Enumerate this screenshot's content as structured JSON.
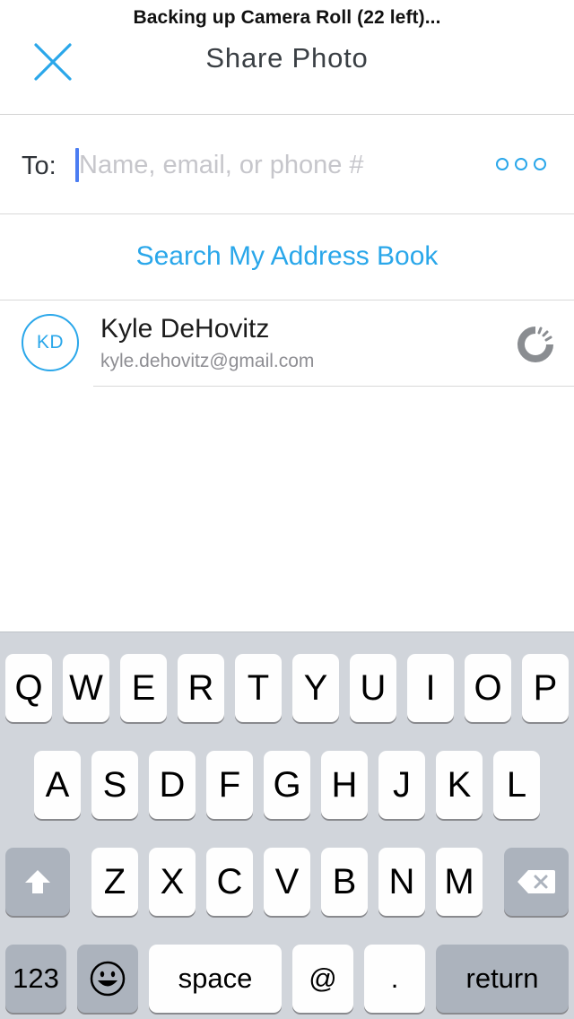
{
  "status": {
    "text": "Backing up Camera Roll (22 left)..."
  },
  "nav": {
    "title": "Share Photo",
    "close_icon": "close-icon"
  },
  "recipient": {
    "label": "To:",
    "value": "",
    "placeholder": "Name, email, or phone #",
    "more_icon": "more-icon"
  },
  "address_book": {
    "label": "Search My Address Book"
  },
  "contacts": [
    {
      "initials": "KD",
      "name": "Kyle DeHovitz",
      "email": "kyle.dehovitz@gmail.com",
      "status_icon": "loading-spinner-icon"
    }
  ],
  "keyboard": {
    "row1": [
      "Q",
      "W",
      "E",
      "R",
      "T",
      "Y",
      "U",
      "I",
      "O",
      "P"
    ],
    "row2": [
      "A",
      "S",
      "D",
      "F",
      "G",
      "H",
      "J",
      "K",
      "L"
    ],
    "row3": [
      "Z",
      "X",
      "C",
      "V",
      "B",
      "N",
      "M"
    ],
    "numbers_label": "123",
    "emoji_icon": "emoji-icon",
    "space_label": "space",
    "at_label": "@",
    "period_label": ".",
    "return_label": "return",
    "shift_icon": "shift-icon",
    "backspace_icon": "backspace-icon"
  },
  "colors": {
    "accent": "#2aa7ea",
    "caret": "#4b7df2",
    "keyboard_bg": "#d1d5db",
    "key_dark": "#acb3bd"
  }
}
